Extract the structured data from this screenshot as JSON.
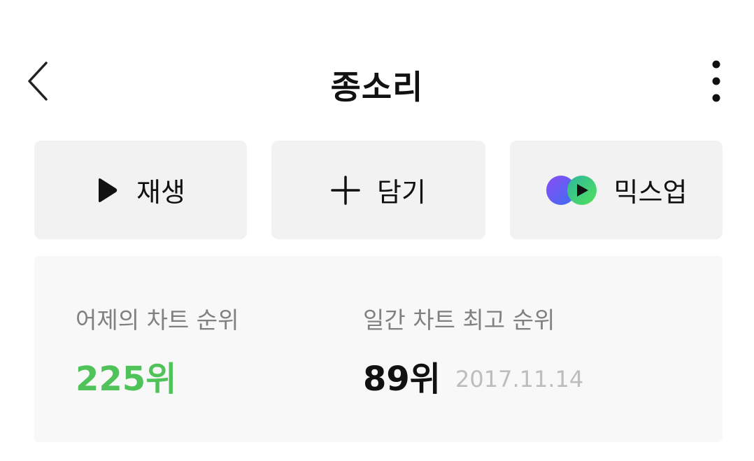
{
  "header": {
    "title": "종소리",
    "back_icon": "chevron-left-icon",
    "more_icon": "more-vertical-icon"
  },
  "actions": {
    "play_label": "재생",
    "add_label": "담기",
    "mixup_label": "믹스업"
  },
  "chart": {
    "yesterday_label": "어제의 차트 순위",
    "yesterday_rank": "225위",
    "peak_label": "일간 차트 최고 순위",
    "peak_rank": "89위",
    "peak_date": "2017.11.14"
  },
  "colors": {
    "accent_green": "#4fc35a",
    "button_bg": "#f2f2f2",
    "panel_bg": "#f8f8f8"
  }
}
